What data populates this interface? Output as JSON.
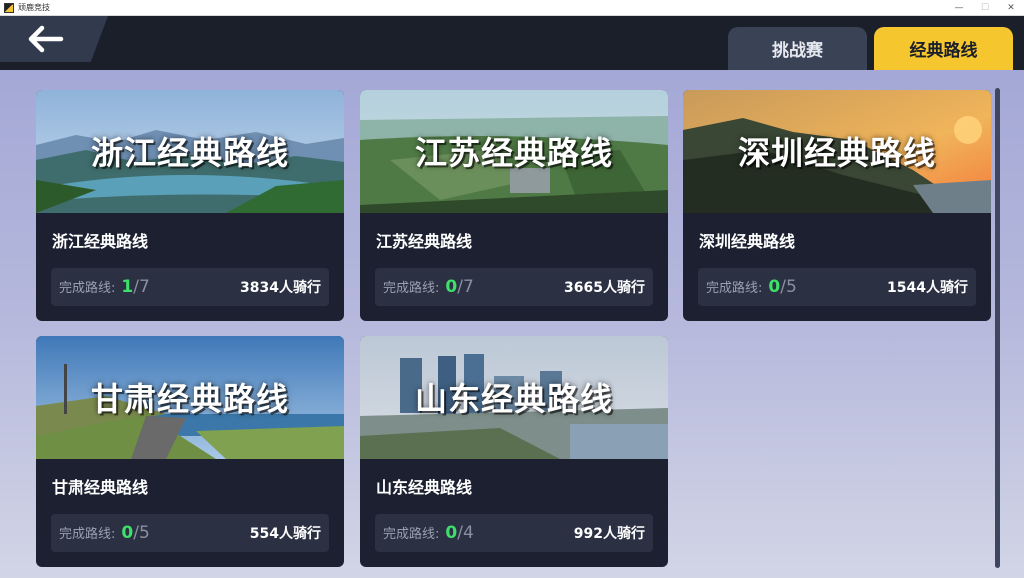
{
  "window": {
    "title": "顽鹿竞技",
    "minimize": "—",
    "maximize": "☐",
    "close": "✕"
  },
  "header": {
    "back_icon": "arrow-left-icon",
    "tabs": [
      {
        "label": "挑战赛",
        "active": false
      },
      {
        "label": "经典路线",
        "active": true
      }
    ]
  },
  "colors": {
    "accent": "#f5c62e",
    "done": "#3ee06a",
    "card": "#1c2030",
    "header": "#1b1f2a"
  },
  "cards": [
    {
      "banner_text": "浙江经典路线",
      "name": "浙江经典路线",
      "progress_label": "完成路线:",
      "done": "1",
      "sep": "/",
      "total": "7",
      "riders": "3834人骑行"
    },
    {
      "banner_text": "江苏经典路线",
      "name": "江苏经典路线",
      "progress_label": "完成路线:",
      "done": "0",
      "sep": "/",
      "total": "7",
      "riders": "3665人骑行"
    },
    {
      "banner_text": "深圳经典路线",
      "name": "深圳经典路线",
      "progress_label": "完成路线:",
      "done": "0",
      "sep": "/",
      "total": "5",
      "riders": "1544人骑行"
    },
    {
      "banner_text": "甘肃经典路线",
      "name": "甘肃经典路线",
      "progress_label": "完成路线:",
      "done": "0",
      "sep": "/",
      "total": "5",
      "riders": "554人骑行"
    },
    {
      "banner_text": "山东经典路线",
      "name": "山东经典路线",
      "progress_label": "完成路线:",
      "done": "0",
      "sep": "/",
      "total": "4",
      "riders": "992人骑行"
    }
  ]
}
